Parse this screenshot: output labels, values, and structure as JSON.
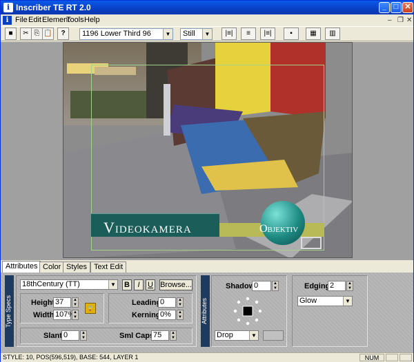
{
  "window": {
    "title": "Inscriber TE RT 2.0"
  },
  "menu": [
    "File",
    "Edit",
    "Element",
    "Tools",
    "Help"
  ],
  "toolbar": {
    "template_value": "1196 Lower Third 96",
    "mode_value": "Still",
    "help_label": "?"
  },
  "canvas": {
    "title_main": "Videokamera",
    "title_sub": "Objektiv"
  },
  "tabs": [
    {
      "label": "Attributes",
      "active": true
    },
    {
      "label": "Color",
      "active": false
    },
    {
      "label": "Styles",
      "active": false
    },
    {
      "label": "Text Edit",
      "active": false
    }
  ],
  "type_specs": {
    "header": "Type Specs",
    "font": "18thCentury (TT)",
    "bold_label": "B",
    "italic_label": "I",
    "underline_label": "U",
    "browse_label": "Browse...",
    "height_label": "Height",
    "height_value": "37",
    "width_label": "Width",
    "width_value": "107%",
    "leading_label": "Leading",
    "leading_value": "0",
    "kerning_label": "Kerning",
    "kerning_value": "0%",
    "slant_label": "Slant",
    "slant_value": "0",
    "smlcaps_label": "Sml Caps",
    "smlcaps_value": "75"
  },
  "attributes": {
    "header": "Attributes",
    "shadow_label": "Shadow",
    "shadow_value": "0",
    "shadow_type": "Drop",
    "edging_label": "Edging",
    "edging_value": "2",
    "edging_type": "Glow"
  },
  "status": {
    "text": "STYLE: 10, POS(596,519), BASE: 544, LAYER 1",
    "num": "NUM"
  },
  "colors": {
    "titlebar": "#0a3fc4",
    "lower_third": "#1b5e59",
    "lower_third_accent": "#b8ba55"
  }
}
